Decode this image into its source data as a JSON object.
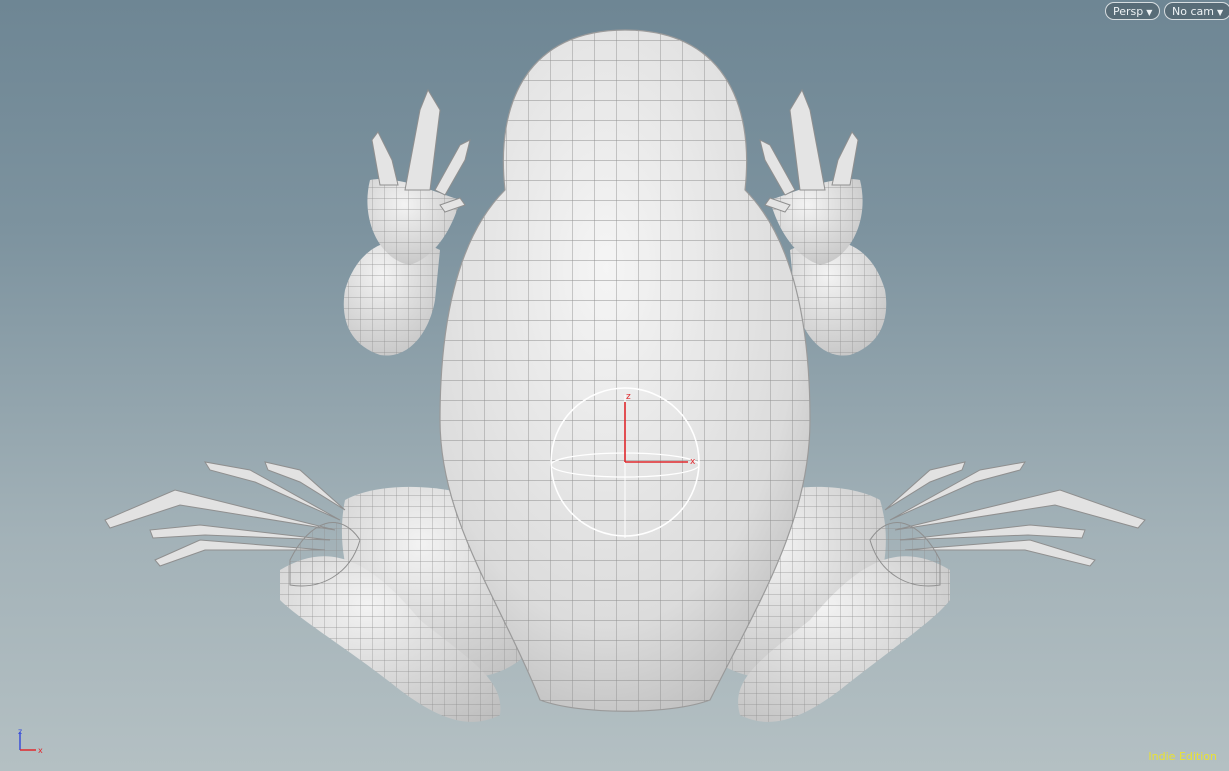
{
  "viewport": {
    "camera_menu": {
      "label": "Persp"
    },
    "camera_select": {
      "label": "No cam"
    },
    "watermark": "Indie Edition",
    "corner_axes": {
      "z": "z",
      "x": "x"
    },
    "handle_axes": {
      "z": "z",
      "x": "x"
    }
  },
  "colors": {
    "background_top": "#6e8694",
    "background_bottom": "#b4c0c3",
    "mesh_fill": "#ececec",
    "wireframe": "#8a8a8a",
    "axis_x": "#e0282d",
    "axis_y": "#3aa83a",
    "axis_z": "#3a4fd8",
    "watermark": "#e9e233"
  },
  "icons": {
    "dropdown": "chevron-down-icon",
    "transform_handle": "transform-handle-icon"
  }
}
